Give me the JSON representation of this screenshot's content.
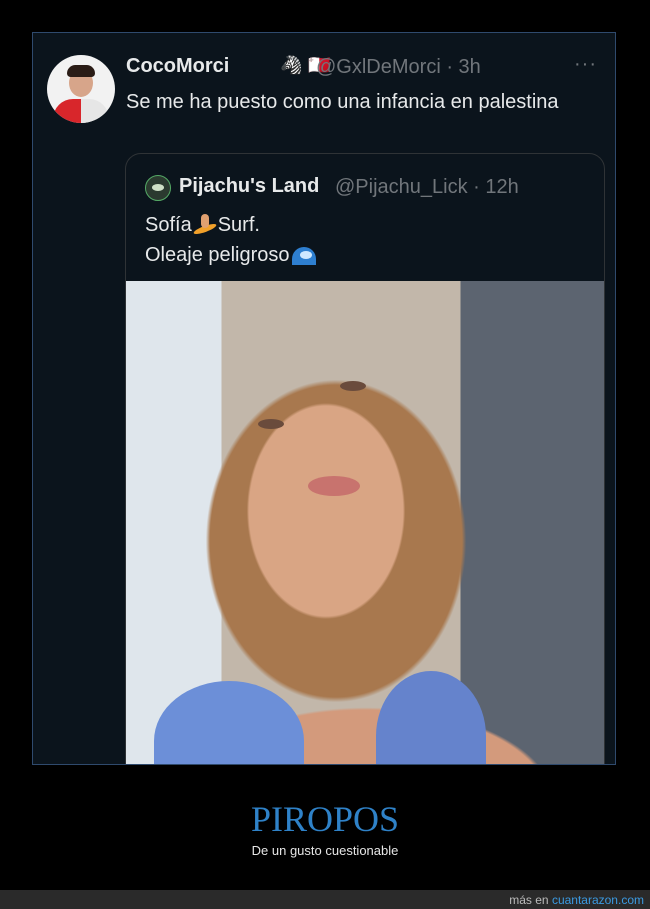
{
  "tweet": {
    "name": "CocoMorci",
    "badges": [
      "🦓",
      "🇲🇹"
    ],
    "handle_time": "@GxlDeMorci · 3h",
    "text": "Se me ha puesto como una infancia en palestina",
    "more": "···"
  },
  "quote": {
    "name": "Pijachu's Land",
    "handle_time": "@Pijachu_Lick · 12h",
    "line1_a": "Sofía",
    "line1_b": "Surf.",
    "line2": "Oleaje peligroso"
  },
  "footer": {
    "title": "PIROPOS",
    "subtitle": "De un gusto cuestionable",
    "mas_en": "más en",
    "site": "cuantarazon.com"
  }
}
